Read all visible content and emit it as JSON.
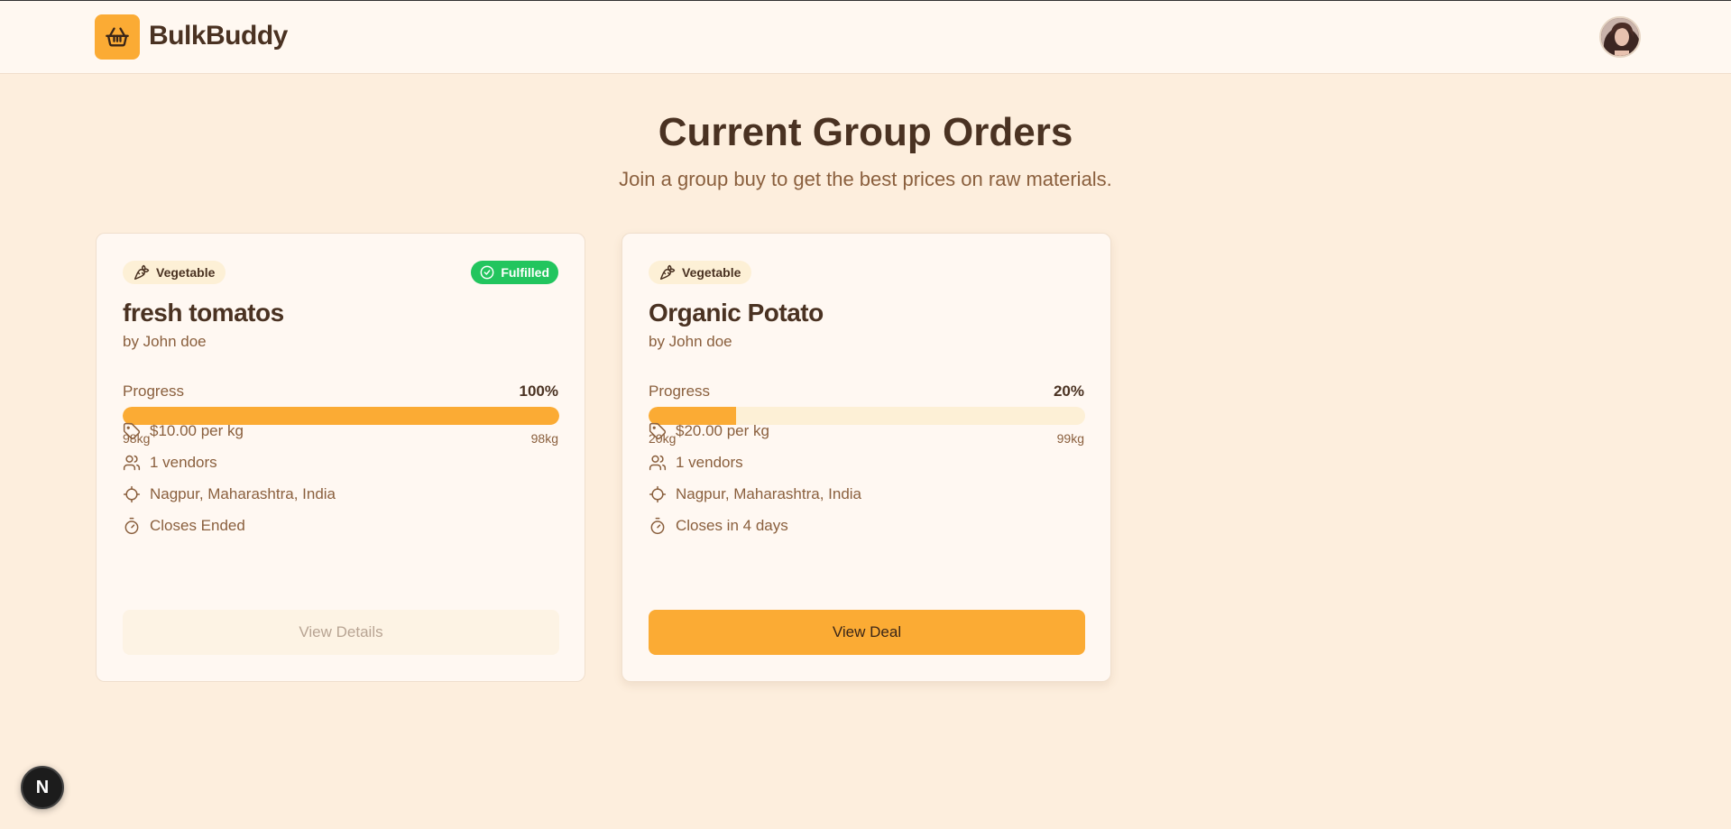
{
  "app": {
    "brand": "BulkBuddy",
    "logo_icon": "basket-icon",
    "accent": "#fbab34"
  },
  "page": {
    "title": "Current Group Orders",
    "subtitle": "Join a group buy to get the best prices on raw materials."
  },
  "orders": [
    {
      "category": "Vegetable",
      "category_icon": "carrot-icon",
      "status": "Fulfilled",
      "status_color": "#22c55e",
      "title": "fresh tomatos",
      "by": "by John doe",
      "progress_label": "Progress",
      "progress_pct": "100%",
      "progress_fraction": 1.0,
      "current_qty": "98kg",
      "target_qty": "98kg",
      "price": "$10.00 per kg",
      "vendors": "1 vendors",
      "location": "Nagpur, Maharashtra, India",
      "closes": "Closes Ended",
      "button": "View Details",
      "button_enabled": false
    },
    {
      "category": "Vegetable",
      "category_icon": "carrot-icon",
      "title": "Organic Potato",
      "by": "by John doe",
      "progress_label": "Progress",
      "progress_pct": "20%",
      "progress_fraction": 0.2,
      "current_qty": "20kg",
      "target_qty": "99kg",
      "price": "$20.00 per kg",
      "vendors": "1 vendors",
      "location": "Nagpur, Maharashtra, India",
      "closes": "Closes in 4 days",
      "button": "View Deal",
      "button_enabled": true
    }
  ],
  "dev_badge": "N"
}
